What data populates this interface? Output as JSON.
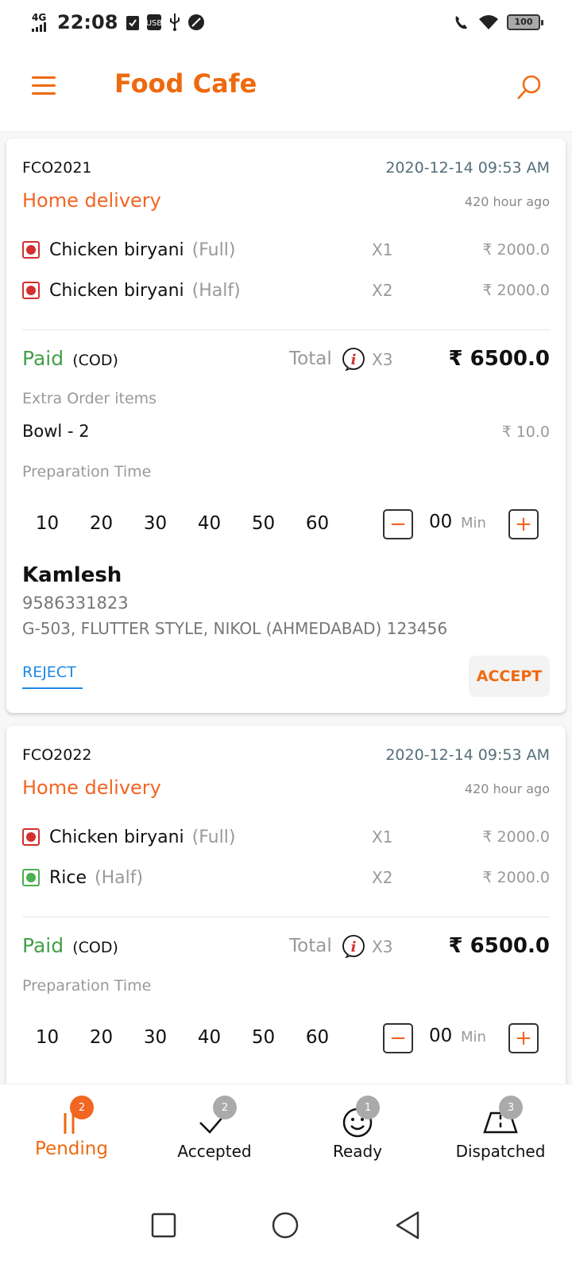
{
  "status_bar": {
    "network": "4G",
    "time": "22:08",
    "battery": "100"
  },
  "app_bar": {
    "title": "Food Cafe"
  },
  "orders": [
    {
      "id": "FCO2021",
      "datetime": "2020-12-14 09:53 AM",
      "delivery_type": "Home delivery",
      "ago": "420 hour ago",
      "items": [
        {
          "name": "Chicken biryani",
          "variant": "(Full)",
          "qty": "X1",
          "price": "₹ 2000.0",
          "type": "nonveg"
        },
        {
          "name": "Chicken biryani",
          "variant": "(Half)",
          "qty": "X2",
          "price": "₹ 2000.0",
          "type": "nonveg"
        }
      ],
      "payment_status": "Paid",
      "payment_mode": "(COD)",
      "total_label": "Total",
      "total_qty": "X3",
      "total_amount": "₹ 6500.0",
      "extra_label": "Extra Order items",
      "extra_items": [
        {
          "name": "Bowl - 2",
          "price": "₹ 10.0"
        }
      ],
      "prep_label": "Preparation Time",
      "prep_options": [
        "10",
        "20",
        "30",
        "40",
        "50",
        "60"
      ],
      "prep_value": "00",
      "prep_unit": "Min",
      "customer": {
        "name": "Kamlesh",
        "phone": "9586331823",
        "address": "G-503, FLUTTER STYLE, NIKOL (AHMEDABAD) 123456"
      },
      "reject_label": "REJECT",
      "accept_label": "ACCEPT"
    },
    {
      "id": "FCO2022",
      "datetime": "2020-12-14 09:53 AM",
      "delivery_type": "Home delivery",
      "ago": "420 hour ago",
      "items": [
        {
          "name": "Chicken biryani",
          "variant": "(Full)",
          "qty": "X1",
          "price": "₹ 2000.0",
          "type": "nonveg"
        },
        {
          "name": "Rice",
          "variant": "(Half)",
          "qty": "X2",
          "price": "₹ 2000.0",
          "type": "veg"
        }
      ],
      "payment_status": "Paid",
      "payment_mode": "(COD)",
      "total_label": "Total",
      "total_qty": "X3",
      "total_amount": "₹ 6500.0",
      "prep_label": "Preparation Time",
      "prep_options": [
        "10",
        "20",
        "30",
        "40",
        "50",
        "60"
      ],
      "prep_value": "00",
      "prep_unit": "Min"
    }
  ],
  "bottom_nav": [
    {
      "label": "Pending",
      "badge": "2",
      "icon": "fork-knife-icon",
      "active": true
    },
    {
      "label": "Accepted",
      "badge": "2",
      "icon": "check-icon",
      "active": false
    },
    {
      "label": "Ready",
      "badge": "1",
      "icon": "smiley-icon",
      "active": false
    },
    {
      "label": "Dispatched",
      "badge": "3",
      "icon": "road-icon",
      "active": false
    }
  ],
  "colors": {
    "brand": "#ee6a0f",
    "delivery": "#f26522",
    "paid": "#43a047",
    "nonveg": "#d32f2f",
    "veg": "#4caf50",
    "reject": "#1e88e5"
  }
}
